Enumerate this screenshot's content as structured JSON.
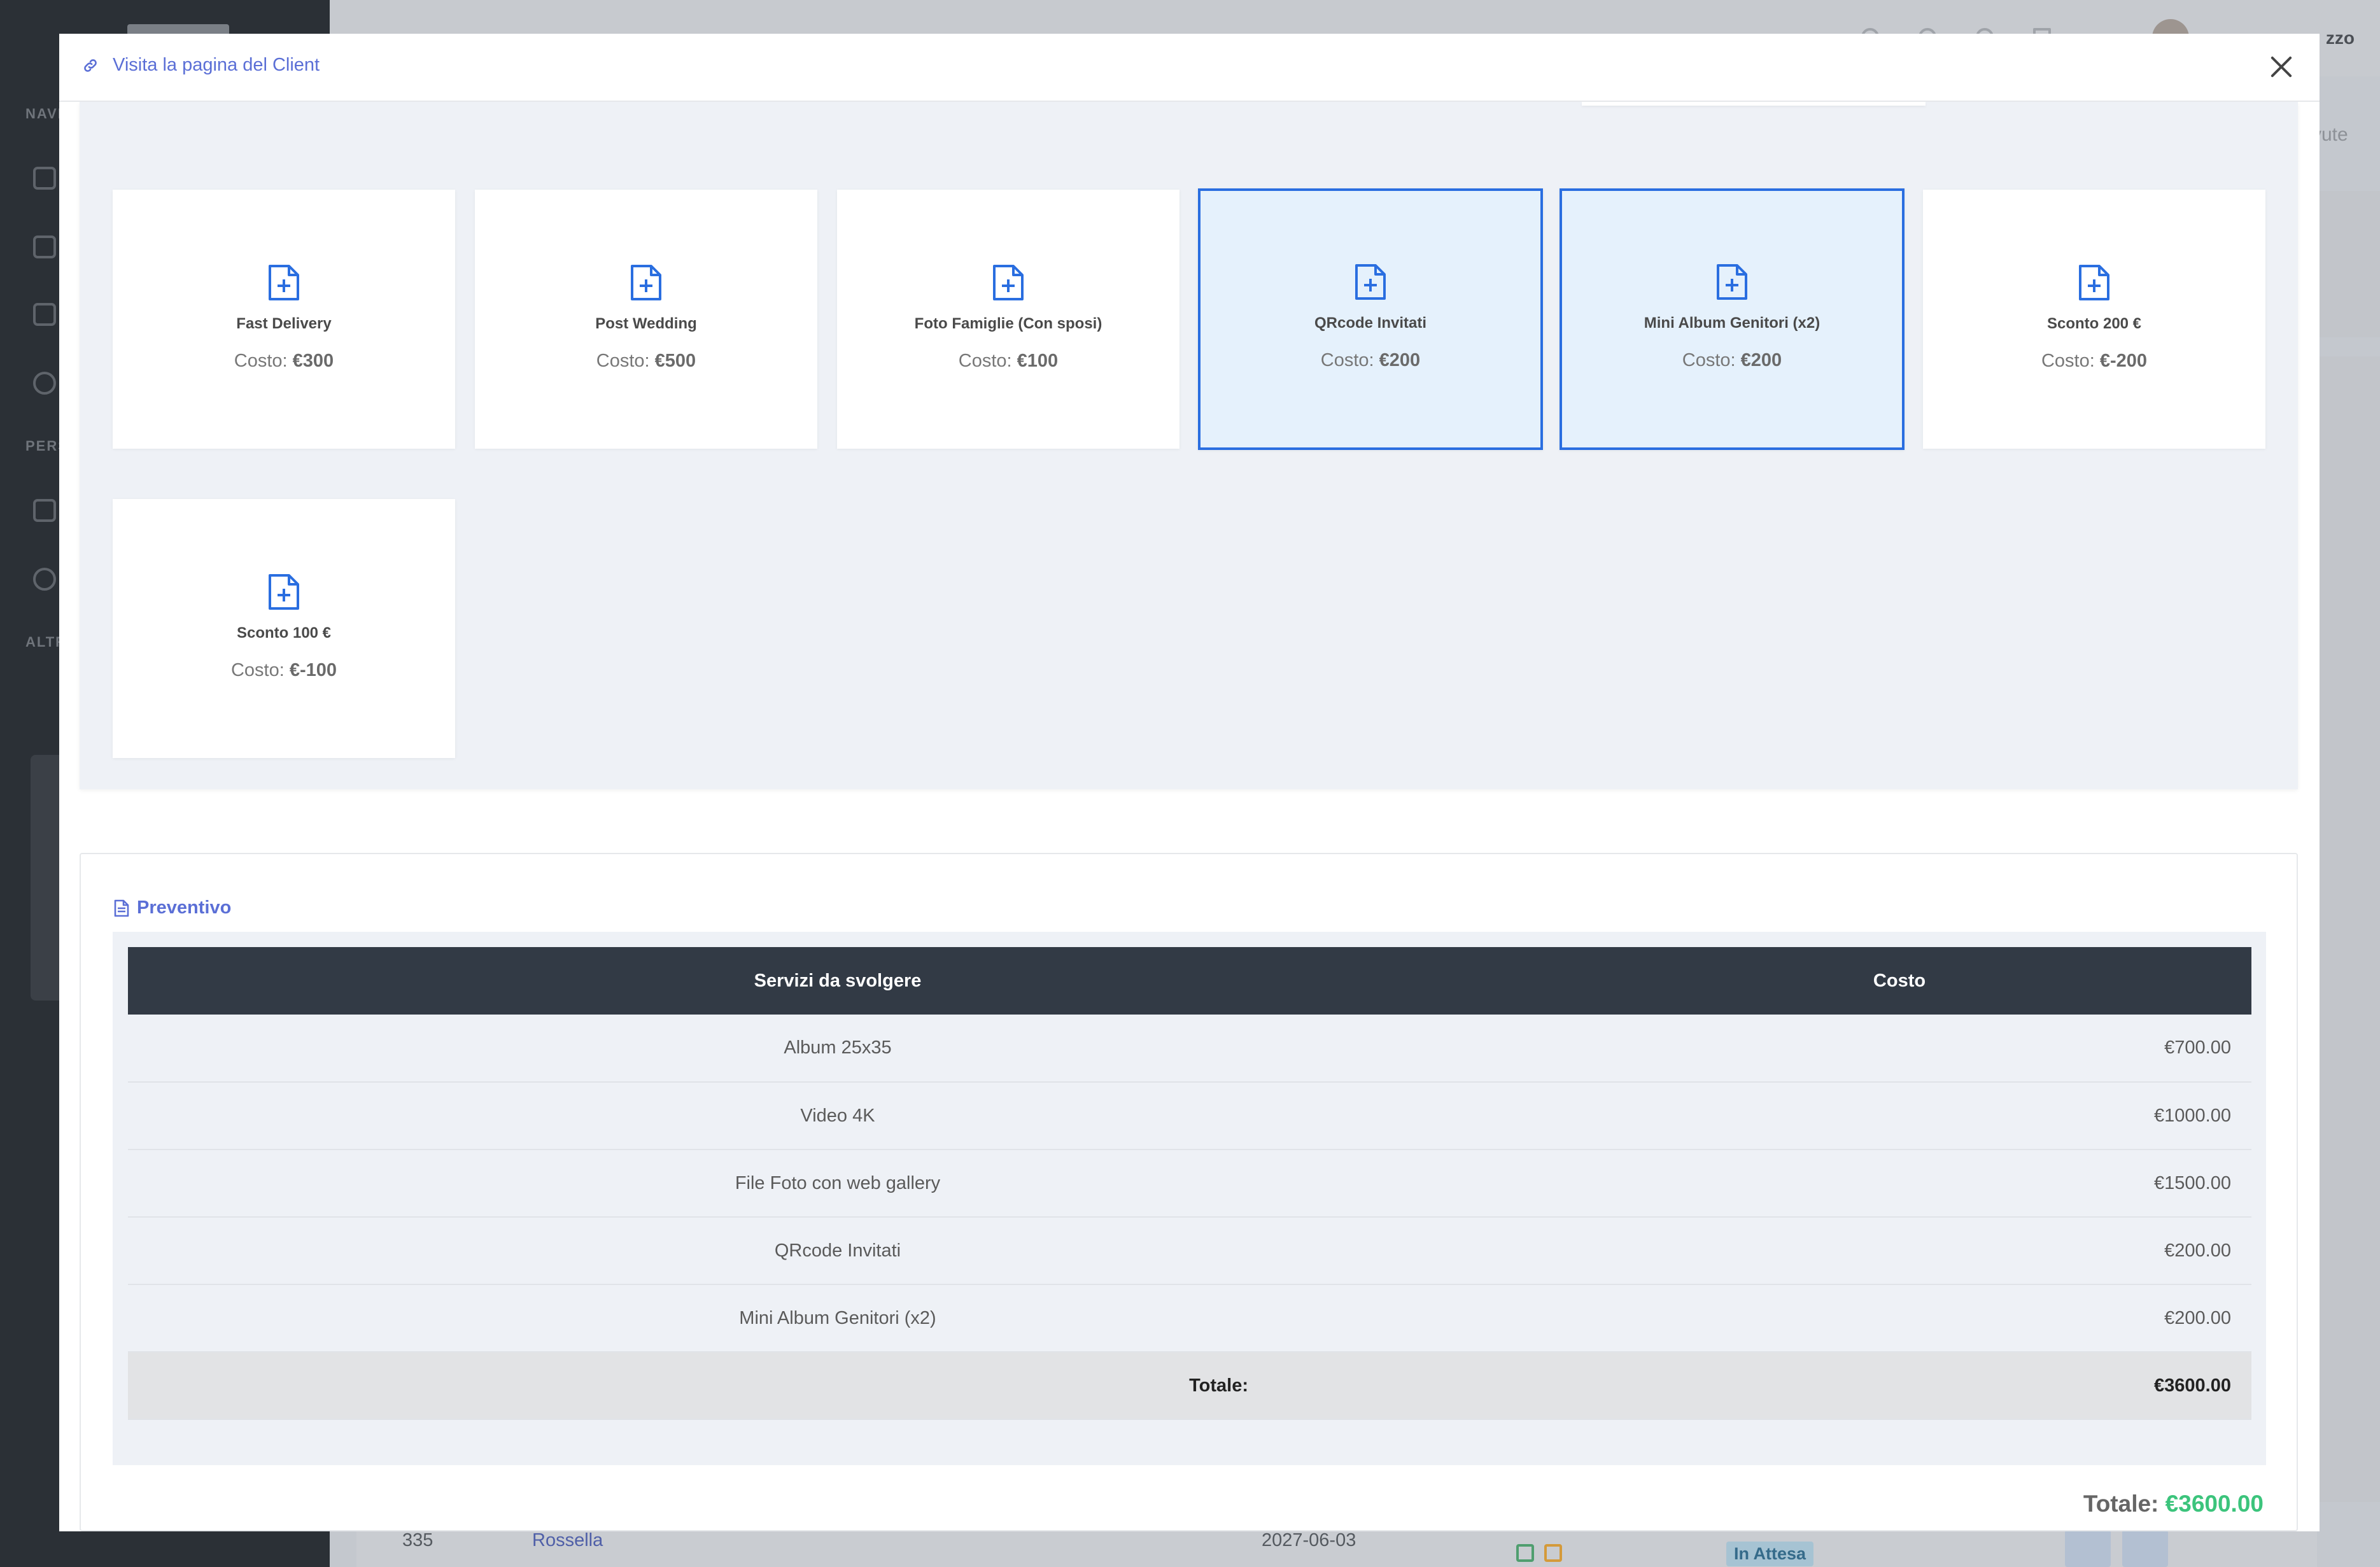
{
  "background": {
    "sidebar_sections": [
      "NAVI",
      "PERS",
      "ALTR"
    ],
    "topbar_user": "zzo",
    "tab_text": "vute",
    "row": {
      "id": "335",
      "name": "Rossella",
      "date": "2027-06-03",
      "status": "In Attesa"
    }
  },
  "modal": {
    "visit_link": "Visita la pagina del Client",
    "cost_prefix": "Costo: ",
    "services": [
      {
        "name": "Fast Delivery",
        "cost": "€300",
        "selected": false
      },
      {
        "name": "Post Wedding",
        "cost": "€500",
        "selected": false
      },
      {
        "name": "Foto Famiglie (Con sposi)",
        "cost": "€100",
        "selected": false
      },
      {
        "name": "QRcode Invitati",
        "cost": "€200",
        "selected": true
      },
      {
        "name": "Mini Album Genitori (x2)",
        "cost": "€200",
        "selected": true
      },
      {
        "name": "Sconto 200 €",
        "cost": "€-200",
        "selected": false
      },
      {
        "name": "Sconto 100 €",
        "cost": "€-100",
        "selected": false
      }
    ],
    "quote": {
      "title": "Preventivo",
      "headers": [
        "Servizi da svolgere",
        "Costo"
      ],
      "rows": [
        {
          "service": "Album 25x35",
          "cost": "€700.00"
        },
        {
          "service": "Video 4K",
          "cost": "€1000.00"
        },
        {
          "service": "File Foto con web gallery",
          "cost": "€1500.00"
        },
        {
          "service": "QRcode Invitati",
          "cost": "€200.00"
        },
        {
          "service": "Mini Album Genitori (x2)",
          "cost": "€200.00"
        }
      ],
      "total_label": "Totale:",
      "total_value": "€3600.00"
    },
    "grand_total_label": "Totale: ",
    "grand_total_value": "€3600.00"
  },
  "colors": {
    "accent": "#5b6fd6",
    "selected_border": "#2a6ee0",
    "selected_bg": "#e5f1fc",
    "table_header": "#323a45",
    "total_green": "#3cc47c"
  }
}
